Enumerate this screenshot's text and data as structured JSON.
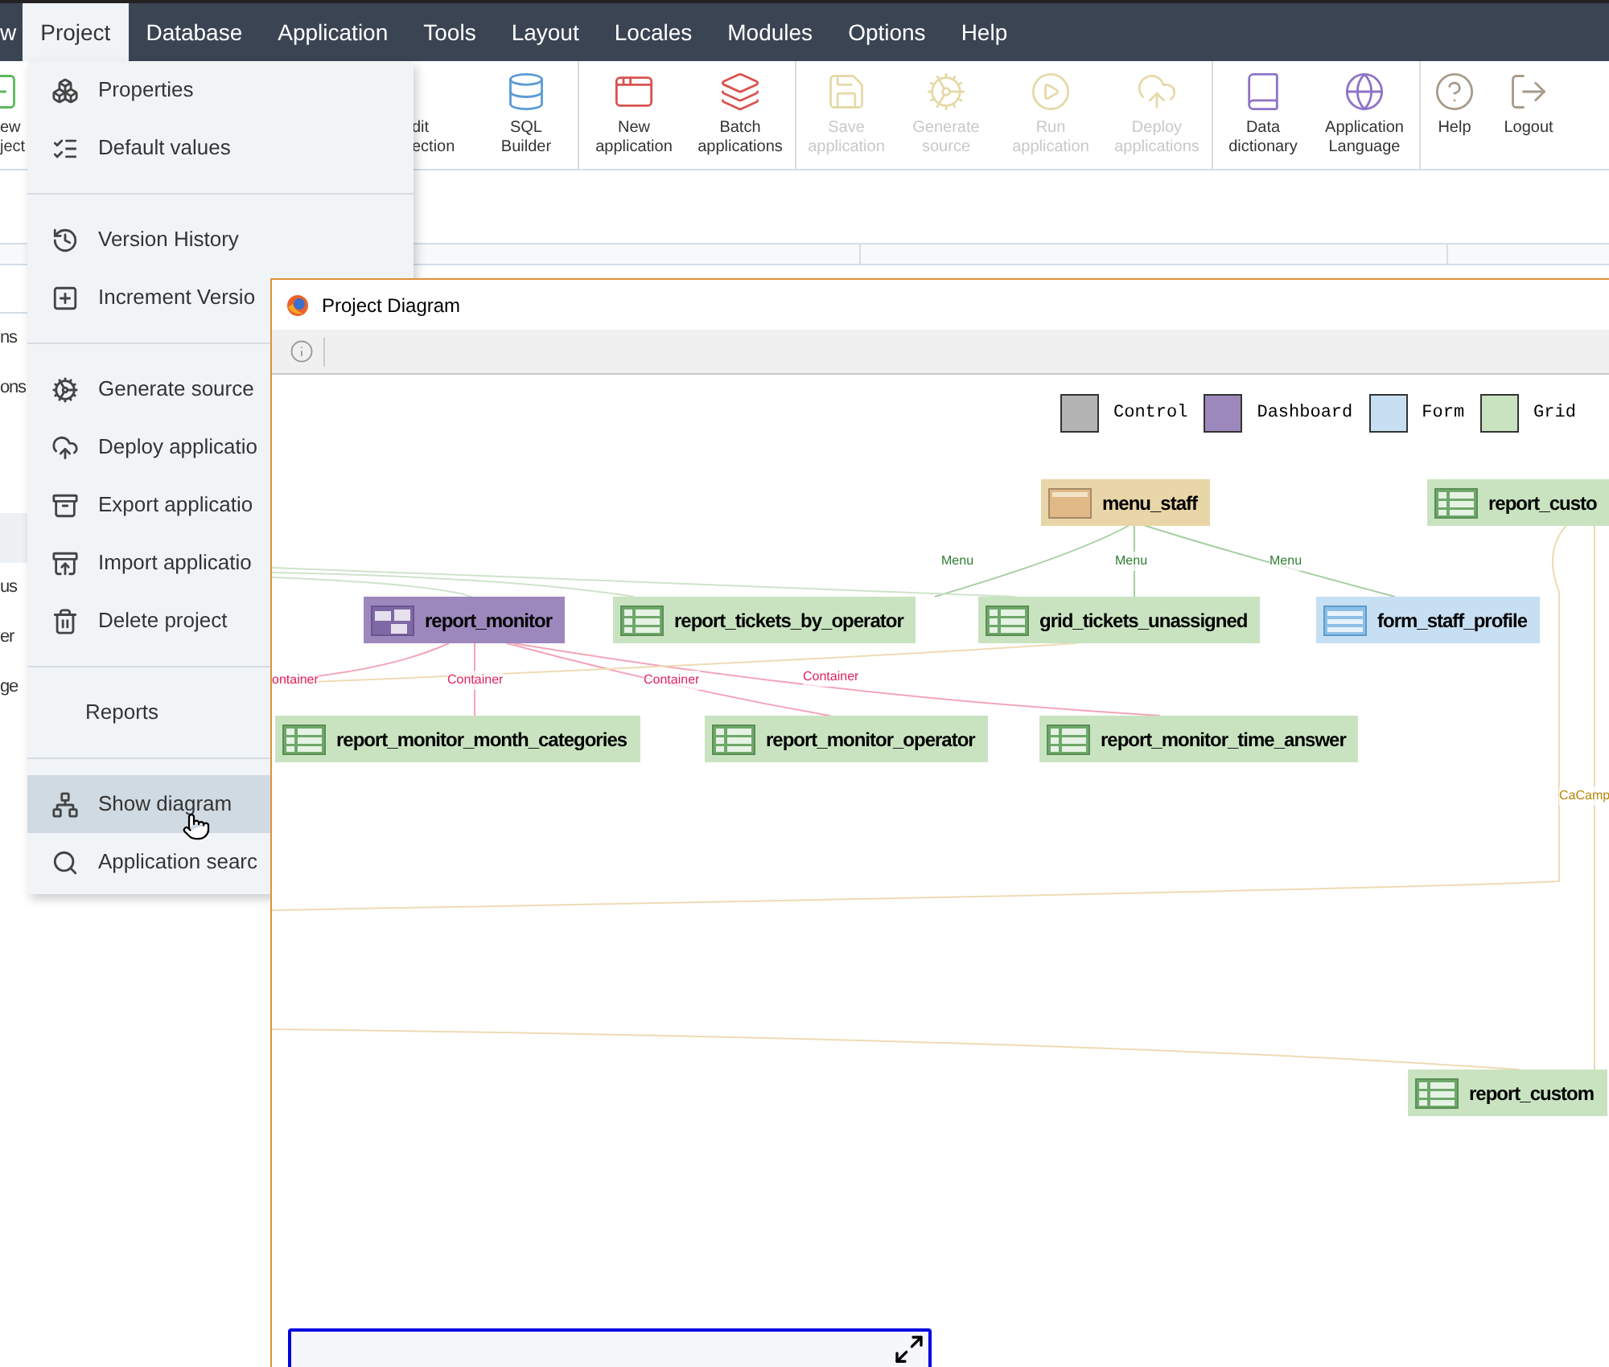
{
  "menubar": [
    {
      "label": "w",
      "selected": false
    },
    {
      "label": "Project",
      "selected": true
    },
    {
      "label": "Database",
      "selected": false
    },
    {
      "label": "Application",
      "selected": false
    },
    {
      "label": "Tools",
      "selected": false
    },
    {
      "label": "Layout",
      "selected": false
    },
    {
      "label": "Locales",
      "selected": false
    },
    {
      "label": "Modules",
      "selected": false
    },
    {
      "label": "Options",
      "selected": false
    },
    {
      "label": "Help",
      "selected": false
    }
  ],
  "toolbar": [
    {
      "lines": [
        "ew",
        "ject"
      ],
      "disabled": false
    },
    {
      "lines": [
        "dit",
        "ection"
      ],
      "disabled": false
    },
    {
      "lines": [
        "SQL",
        "Builder"
      ],
      "disabled": false
    },
    {
      "lines": [
        "New",
        "application"
      ],
      "disabled": false
    },
    {
      "lines": [
        "Batch",
        "applications"
      ],
      "disabled": false
    },
    {
      "lines": [
        "Save",
        "application"
      ],
      "disabled": true
    },
    {
      "lines": [
        "Generate",
        "source"
      ],
      "disabled": true
    },
    {
      "lines": [
        "Run",
        "application"
      ],
      "disabled": true
    },
    {
      "lines": [
        "Deploy",
        "applications"
      ],
      "disabled": true
    },
    {
      "lines": [
        "Data",
        "dictionary"
      ],
      "disabled": false
    },
    {
      "lines": [
        "Application",
        "Language"
      ],
      "disabled": false
    },
    {
      "lines": [
        "Help"
      ],
      "disabled": false
    },
    {
      "lines": [
        "Logout"
      ],
      "disabled": false
    }
  ],
  "sidebar": [
    {
      "label": "ns",
      "selected": false
    },
    {
      "label": "ons",
      "selected": false
    },
    {
      "selected": true
    },
    {
      "label": "us",
      "selected": false
    },
    {
      "label": "er",
      "selected": false
    },
    {
      "label": "ge",
      "selected": false
    }
  ],
  "project_menu": [
    {
      "kind": "item",
      "label": "Properties",
      "selected": false
    },
    {
      "kind": "item",
      "label": "Default values",
      "selected": false
    },
    {
      "kind": "separator"
    },
    {
      "kind": "item",
      "label": "Version History",
      "selected": false
    },
    {
      "kind": "item",
      "label": "Increment Versio",
      "selected": false
    },
    {
      "kind": "separator"
    },
    {
      "kind": "item",
      "label": "Generate source",
      "selected": false
    },
    {
      "kind": "item",
      "label": "Deploy applicatio",
      "selected": false
    },
    {
      "kind": "item",
      "label": "Export applicatio",
      "selected": false
    },
    {
      "kind": "item",
      "label": "Import applicatio",
      "selected": false
    },
    {
      "kind": "item",
      "label": "Delete project",
      "selected": false
    },
    {
      "kind": "separator"
    },
    {
      "kind": "header",
      "label": "Reports"
    },
    {
      "kind": "separator"
    },
    {
      "kind": "item",
      "label": "Show diagram",
      "selected": true
    },
    {
      "kind": "item",
      "label": "Application searc",
      "selected": false
    }
  ],
  "diagram_window": {
    "title": "Project Diagram",
    "legend": [
      {
        "label": "Control",
        "color": "#b3b3b3"
      },
      {
        "label": "Dashboard",
        "color": "#9d88bd"
      },
      {
        "label": "Form",
        "color": "#c7dff2"
      },
      {
        "label": "Grid",
        "color": "#c9e3c0"
      }
    ],
    "nodes": [
      {
        "label": "menu_staff",
        "kind": "menu"
      },
      {
        "label": "report_custo",
        "kind": "grid"
      },
      {
        "label": "report_monitor",
        "kind": "dashboard"
      },
      {
        "label": "report_tickets_by_operator",
        "kind": "grid"
      },
      {
        "label": "grid_tickets_unassigned",
        "kind": "grid"
      },
      {
        "label": "form_staff_profile",
        "kind": "form"
      },
      {
        "label": "report_monitor_month_categories",
        "kind": "grid"
      },
      {
        "label": "report_monitor_operator",
        "kind": "grid"
      },
      {
        "label": "report_monitor_time_answer",
        "kind": "grid"
      },
      {
        "label": "report_custom",
        "kind": "grid"
      }
    ],
    "edge_labels": [
      {
        "text": "Menu",
        "kind": "menu"
      },
      {
        "text": "Menu",
        "kind": "menu"
      },
      {
        "text": "Menu",
        "kind": "menu"
      },
      {
        "text": "ontainer",
        "kind": "container"
      },
      {
        "text": "Container",
        "kind": "container"
      },
      {
        "text": "Container",
        "kind": "container"
      },
      {
        "text": "Container",
        "kind": "container"
      },
      {
        "text": "CaCamp",
        "kind": "other"
      }
    ]
  }
}
